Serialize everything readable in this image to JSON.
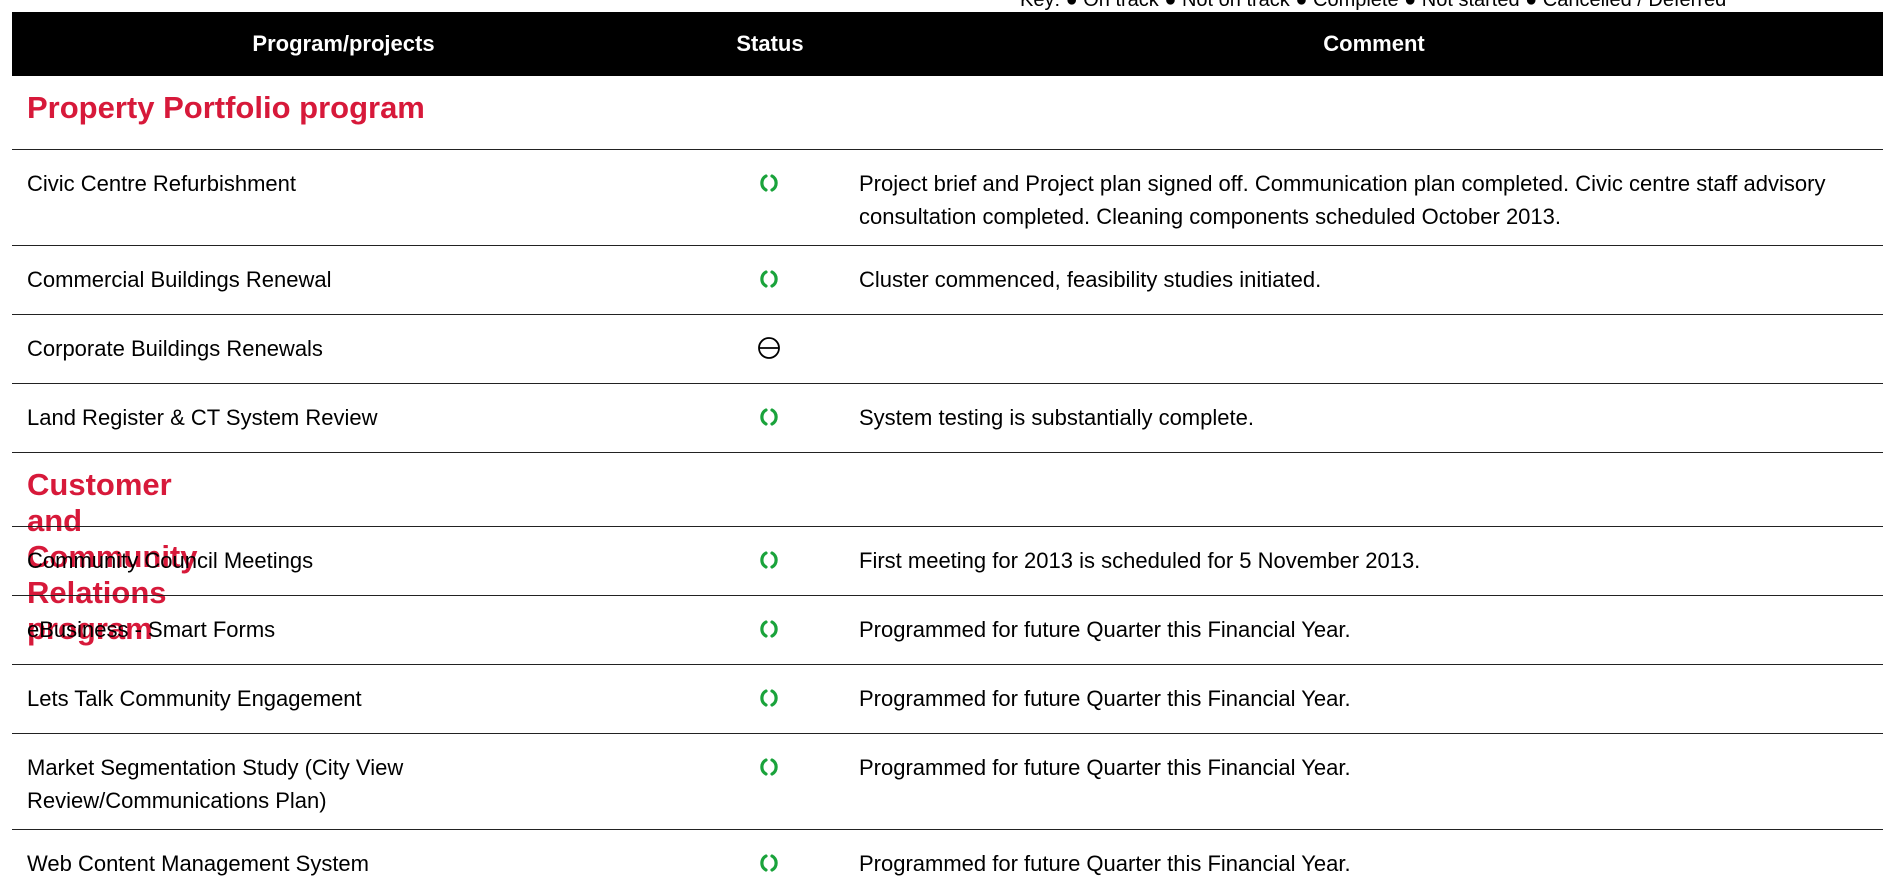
{
  "legend_text": "Key: ● On track  ● Not on track  ● Complete  ● Not started  ● Cancelled / Deferred",
  "headers": {
    "project": "Program/projects",
    "status": "Status",
    "comment": "Comment"
  },
  "colors": {
    "accent": "#d7193a",
    "on_track": "#1aa33b",
    "header_bg": "#000000"
  },
  "sections": [
    {
      "title": "Property Portfolio program",
      "rows": [
        {
          "project": "Civic Centre Refurbishment",
          "status_icon": "on-track-icon",
          "comment": "Project brief and Project plan signed off. Communication plan completed. Civic centre staff advisory consultation completed. Cleaning components scheduled October 2013."
        },
        {
          "project": "Commercial Buildings Renewal",
          "status_icon": "on-track-icon",
          "comment": "Cluster commenced, feasibility studies initiated."
        },
        {
          "project": "Corporate Buildings Renewals",
          "status_icon": "not-started-icon",
          "comment": ""
        },
        {
          "project": "Land Register & CT System Review",
          "status_icon": "on-track-icon",
          "comment": "System testing is substantially complete."
        }
      ]
    },
    {
      "title": "Customer and Community Relations program",
      "rows": [
        {
          "project": "Community Council Meetings",
          "status_icon": "on-track-icon",
          "comment": "First meeting for 2013 is scheduled for 5 November 2013."
        },
        {
          "project": "eBusiness - Smart Forms",
          "status_icon": "on-track-icon",
          "comment": "Programmed for future Quarter this Financial Year."
        },
        {
          "project": "Lets Talk Community Engagement",
          "status_icon": "on-track-icon",
          "comment": "Programmed for future Quarter this Financial Year."
        },
        {
          "project": "Market Segmentation Study (City View Review/Communications Plan)",
          "status_icon": "on-track-icon",
          "comment": "Programmed for future Quarter this Financial Year."
        },
        {
          "project": "Web Content Management System",
          "status_icon": "on-track-icon",
          "comment": "Programmed for future Quarter this Financial Year."
        }
      ]
    }
  ]
}
